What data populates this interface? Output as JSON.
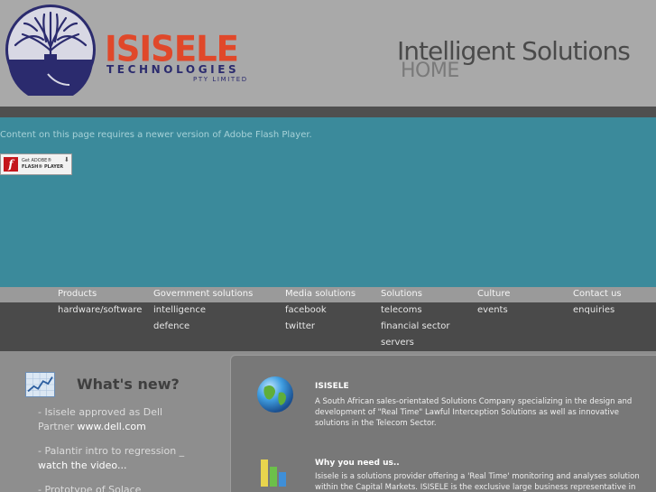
{
  "header": {
    "logo_name": "ISISELE",
    "logo_sub": "TECHNOLOGIES",
    "logo_pty": "PTY LIMITED",
    "tagline": "Intelligent Solutions",
    "page_label": "HOME"
  },
  "flash": {
    "message": "Content on this page requires a newer version of Adobe Flash Player.",
    "button_line1": "Get ADOBE®",
    "button_line2": "FLASH® PLAYER"
  },
  "nav": {
    "products": {
      "label": "Products",
      "items": [
        "hardware/software"
      ]
    },
    "government": {
      "label": "Government solutions",
      "items": [
        "intelligence",
        "defence"
      ]
    },
    "media": {
      "label": "Media solutions",
      "items": [
        "facebook",
        "twitter"
      ]
    },
    "solutions": {
      "label": "Solutions",
      "items": [
        "telecoms",
        "financial sector",
        "servers"
      ]
    },
    "culture": {
      "label": "Culture",
      "items": [
        "events"
      ]
    },
    "contact": {
      "label": "Contact us",
      "items": [
        "enquiries"
      ]
    }
  },
  "whats_new": {
    "title": "What's new?",
    "news": [
      {
        "text": "- Isisele approved as Dell Partner ",
        "link": "www.dell.com"
      },
      {
        "text": "- Palantir intro to regression _ ",
        "link": "watch the video..."
      },
      {
        "text": "- Prototype of Solace",
        "link": ""
      }
    ]
  },
  "panel": {
    "section1_title": "ISISELE",
    "section1_text": "A South African sales-orientated Solutions Company specializing in the design and development of \"Real Time\" Lawful Interception Solutions as well as innovative solutions in the Telecom Sector.",
    "section2_title": "Why you need us..",
    "section2_text": "Isisele is a solutions provider offering a 'Real Time' monitoring and analyses solution within the Capital Markets. ISISELE is the exclusive large business representative in SA"
  },
  "colors": {
    "brand_red": "#e0482a",
    "brand_navy": "#2b2b6e",
    "flash_bg": "#3b8a9b"
  }
}
